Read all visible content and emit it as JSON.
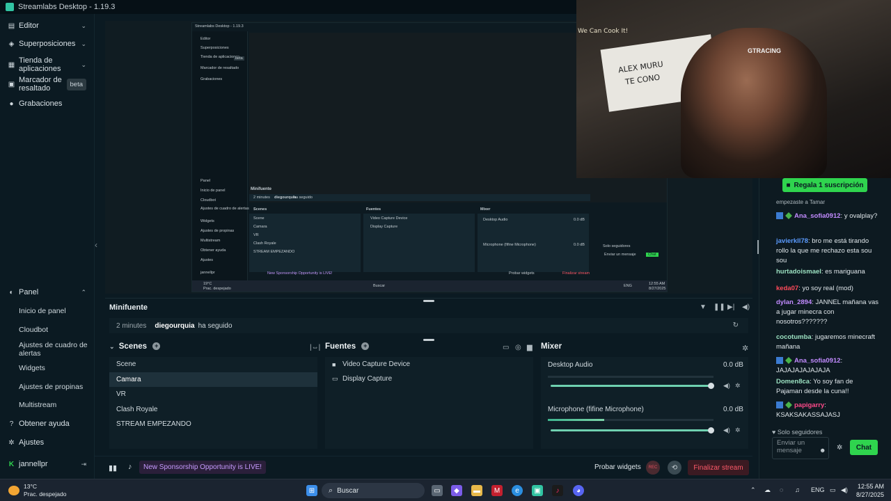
{
  "window": {
    "title": "Streamlabs Desktop - 1.19.3"
  },
  "sidebar": {
    "top_items": [
      {
        "label": "Editor",
        "icon": "editor-icon"
      },
      {
        "label": "Superposiciones",
        "icon": "layers-icon"
      },
      {
        "label": "Tienda de aplicaciones",
        "icon": "store-icon"
      },
      {
        "label": "Marcador de resaltado",
        "icon": "highlight-icon",
        "badge": "beta"
      },
      {
        "label": "Grabaciones",
        "icon": "record-icon"
      }
    ],
    "panel": {
      "label": "Panel",
      "items": [
        "Inicio de panel",
        "Cloudbot",
        "Ajustes de cuadro de alertas",
        "Widgets",
        "Ajustes de propinas",
        "Multistream"
      ]
    },
    "bottom_items": [
      {
        "label": "Obtener ayuda",
        "icon": "help-icon"
      },
      {
        "label": "Ajustes",
        "icon": "settings-icon"
      }
    ],
    "user": "jannellpr"
  },
  "nested_preview": {
    "title": "Streamlabs Desktop - 1.19.3",
    "nav": [
      "Editor",
      "Superposiciones",
      "Tienda de aplicaciones",
      "Marcador de resaltado",
      "Grabaciones"
    ],
    "panel": [
      "Panel",
      "Inicio de panel",
      "Cloudbot",
      "Ajustes de cuadro de alertas",
      "Widgets",
      "Ajustes de propinas",
      "Multistream",
      "Obtener ayuda",
      "Ajustes",
      "jannellpr"
    ],
    "beta": "beta",
    "minifuente": "Minifuente",
    "event": "2 minutes",
    "event_user": "diegourquia",
    "event_action": "ha seguido",
    "scenes_title": "Scenes",
    "scenes": [
      "Scene",
      "Camara",
      "VR",
      "Clash Royale",
      "STREAM EMPEZANDO"
    ],
    "sources_title": "Fuentes",
    "sources": [
      "Video Capture Device",
      "Display Capture"
    ],
    "mixer_title": "Mixer",
    "mixer": [
      "Desktop Audio",
      "Microphone (fifine Microphone)"
    ],
    "mixer_db": "0.0 dB",
    "sponsor": "New Sponsorship Opportunity is LIVE!",
    "probar": "Probar widgets",
    "finalizar": "Finalizar stream",
    "buscar": "Buscar",
    "chat_btn": "Chat",
    "chat_input": "Enviar un mensaje",
    "solo": "Solo seguidores",
    "weather": "19°C",
    "weather_desc": "Prac. despejado",
    "clock_time": "12:55 AM",
    "clock_date": "8/27/2025",
    "lang": "ENG"
  },
  "webcam": {
    "cap_brand": "GTRACING",
    "wall_sign": "ALEX MURU",
    "wall_sign2": "TE CONO",
    "poster": "We Can Cook It!"
  },
  "minifuente": {
    "title": "Minifuente",
    "event": {
      "time": "2 minutes",
      "user": "diegourquia",
      "action": "ha seguido"
    }
  },
  "scenes": {
    "title": "Scenes",
    "items": [
      "Scene",
      "Camara",
      "VR",
      "Clash Royale",
      "STREAM EMPEZANDO"
    ],
    "selected_index": 1
  },
  "sources": {
    "title": "Fuentes",
    "items": [
      {
        "label": "Video Capture Device",
        "icon": "camera-icon"
      },
      {
        "label": "Display Capture",
        "icon": "monitor-icon"
      }
    ]
  },
  "mixer": {
    "title": "Mixer",
    "channels": [
      {
        "label": "Desktop Audio",
        "db": "0.0 dB",
        "level": 0.0,
        "volume": 1.0
      },
      {
        "label": "Microphone (fifine Microphone)",
        "db": "0.0 dB",
        "level": 0.34,
        "volume": 1.0
      }
    ]
  },
  "footer": {
    "sponsor": "New Sponsorship Opportunity is LIVE!",
    "probar": "Probar widgets",
    "rec": "REC",
    "finalizar": "Finalizar stream"
  },
  "chat": {
    "gift_button": "Regala 1 suscripción",
    "partial_top": "empezaste a Tamar",
    "messages": [
      {
        "user": "Ana_sofia0912",
        "color": "#c28bff",
        "text": ": y ovalplay?",
        "badges": true
      },
      {
        "user": "javierkll78",
        "color": "#5b9bff",
        "text": ": bro me está tirando rollo la que me rechazo esta sou sou",
        "badges": false
      },
      {
        "user": "hurtadoismael",
        "color": "#9be0c0",
        "text": ": es mariguana",
        "badges": false
      },
      {
        "user": "keda07",
        "color": "#ff4a5a",
        "text": ": yo soy real (mod)",
        "badges": false
      },
      {
        "user": "dylan_2894",
        "color": "#c28bff",
        "text": ": JANNEL mañana vas a jugar minecra con nosotros???????",
        "badges": false
      },
      {
        "user": "cocotumba",
        "color": "#9be0c0",
        "text": ": jugaremos minecraft mañana",
        "badges": false
      },
      {
        "user": "Ana_sofia0912",
        "color": "#c28bff",
        "text": ": JAJAJAJAJAJAJA",
        "badges": true
      },
      {
        "user": "Domen8ca",
        "color": "#9be0c0",
        "text": ": Yo soy fan de Pajaman desde la cuna!!",
        "badges": false
      },
      {
        "user": "papigarry",
        "color": "#ff4a8a",
        "text": ": KSAKSAKASSAJASJ",
        "badges": true
      }
    ],
    "followers_only": "Solo seguidores",
    "input_placeholder": "Enviar un mensaje",
    "send_label": "Chat"
  },
  "taskbar": {
    "weather_temp": "13°C",
    "weather_desc": "Prac. despejado",
    "search_placeholder": "Buscar",
    "language": "ENG",
    "time": "12:55 AM",
    "date": "8/27/2025"
  }
}
